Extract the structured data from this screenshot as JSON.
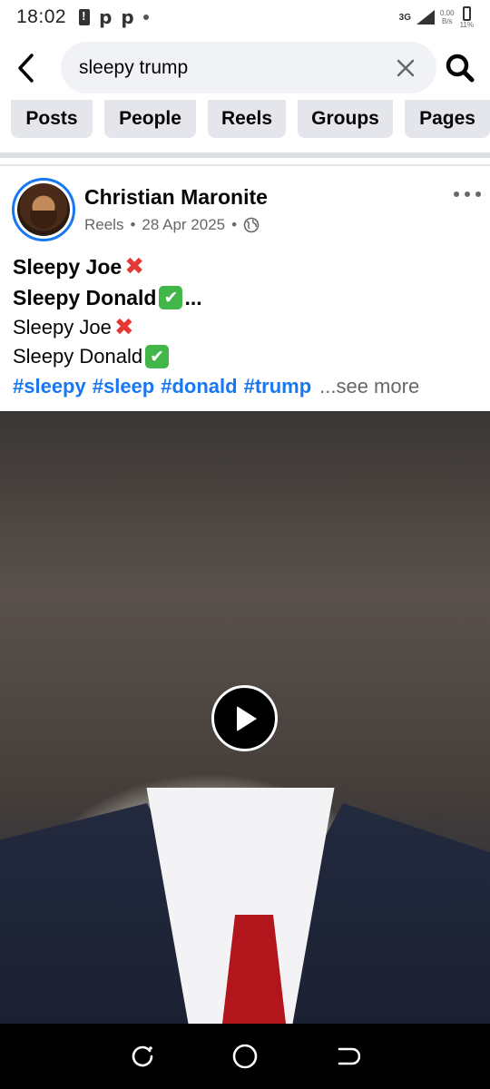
{
  "status_bar": {
    "time": "18:02",
    "network": "3G",
    "speed_value": "0.00",
    "speed_unit": "B/s",
    "battery": "11%"
  },
  "search": {
    "query": "sleepy trump"
  },
  "tabs": [
    {
      "label": "Posts"
    },
    {
      "label": "People"
    },
    {
      "label": "Reels"
    },
    {
      "label": "Groups"
    },
    {
      "label": "Pages"
    }
  ],
  "post": {
    "author": "Christian Maronite",
    "source": "Reels",
    "date": "28 Apr 2025",
    "lines_bold": [
      "Sleepy Joe",
      "Sleepy Donald"
    ],
    "bold_ellipsis": "...",
    "lines_regular": [
      "Sleepy Joe",
      "Sleepy Donald"
    ],
    "hashtags": [
      "#sleepy",
      "#sleep",
      "#donald",
      "#trump"
    ],
    "see_more": "...see more"
  },
  "colors": {
    "accent": "#1877f2",
    "secondary_text": "#65676b",
    "chip_bg": "#e4e6eb"
  }
}
